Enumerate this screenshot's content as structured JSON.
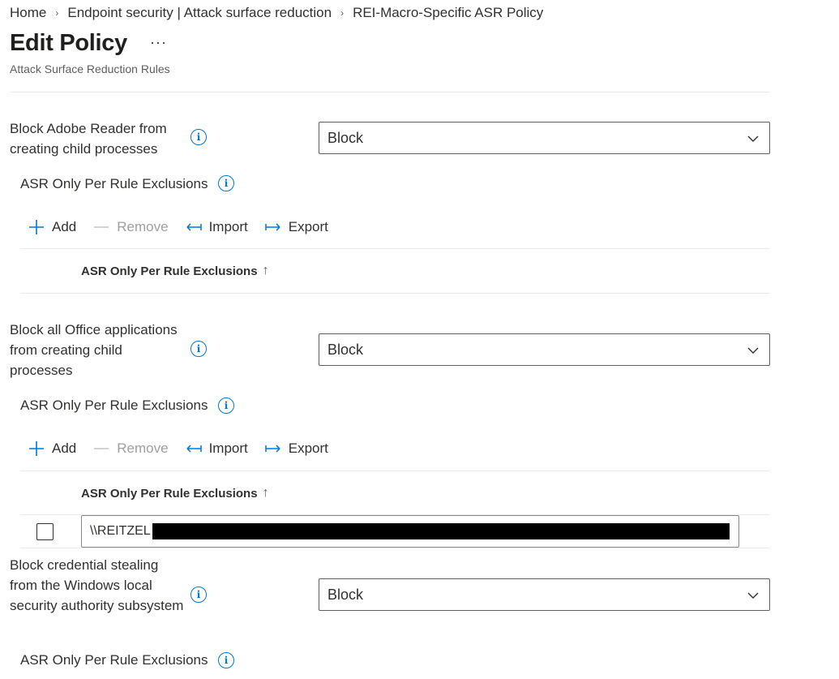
{
  "breadcrumb": {
    "items": [
      "Home",
      "Endpoint security | Attack surface reduction",
      "REI-Macro-Specific ASR Policy"
    ],
    "separator": "›"
  },
  "header": {
    "title": "Edit Policy",
    "more_label": "···",
    "subtitle": "Attack Surface Reduction Rules"
  },
  "toolbar": {
    "add": "Add",
    "remove": "Remove",
    "import": "Import",
    "export": "Export"
  },
  "rules": [
    {
      "label": "Block Adobe Reader from creating child processes",
      "value": "Block",
      "exclusions_label": "ASR Only Per Rule Exclusions",
      "column_header": "ASR Only Per Rule Exclusions",
      "rows": []
    },
    {
      "label": "Block all Office applications from creating child processes",
      "value": "Block",
      "exclusions_label": "ASR Only Per Rule Exclusions",
      "column_header": "ASR Only Per Rule Exclusions",
      "rows": [
        {
          "value": "\\\\REITZEL"
        }
      ]
    },
    {
      "label": "Block credential stealing from the Windows local security authority subsystem",
      "value": "Block",
      "exclusions_label": "ASR Only Per Rule Exclusions"
    }
  ],
  "colors": {
    "accent": "#0078d4",
    "text": "#323130",
    "disabled": "#a19f9d",
    "divider": "#edebe9"
  },
  "icons": {
    "info": "info-icon",
    "add": "plus-icon",
    "remove": "minus-icon",
    "import": "import-arrow-icon",
    "export": "export-arrow-icon",
    "dropdown": "chevron-down-icon",
    "sort": "arrow-up-icon"
  }
}
